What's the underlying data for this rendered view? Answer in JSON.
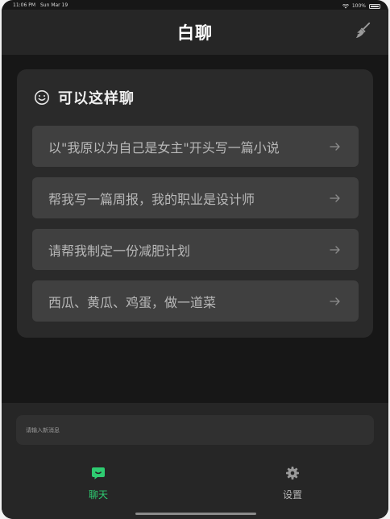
{
  "status_bar": {
    "time": "11:06 PM",
    "date": "Sun Mar 19",
    "battery": "100%"
  },
  "header": {
    "title": "白聊",
    "clean_icon": "broom-icon"
  },
  "panel": {
    "title": "可以这样聊",
    "icon": "smile-icon",
    "suggestions": [
      {
        "text": "以\"我原以为自己是女主\"开头写一篇小说"
      },
      {
        "text": "帮我写一篇周报，我的职业是设计师"
      },
      {
        "text": "请帮我制定一份减肥计划"
      },
      {
        "text": "西瓜、黄瓜、鸡蛋，做一道菜"
      }
    ]
  },
  "input": {
    "placeholder": "请输入新消息"
  },
  "tabs": {
    "chat": {
      "label": "聊天",
      "icon": "chat-bubble-icon",
      "active": true
    },
    "settings": {
      "label": "设置",
      "icon": "gear-icon",
      "active": false
    }
  },
  "colors": {
    "background": "#171717",
    "header": "#262626",
    "panel": "#2a2a2a",
    "suggestion": "#404040",
    "accent": "#2ecc71"
  }
}
